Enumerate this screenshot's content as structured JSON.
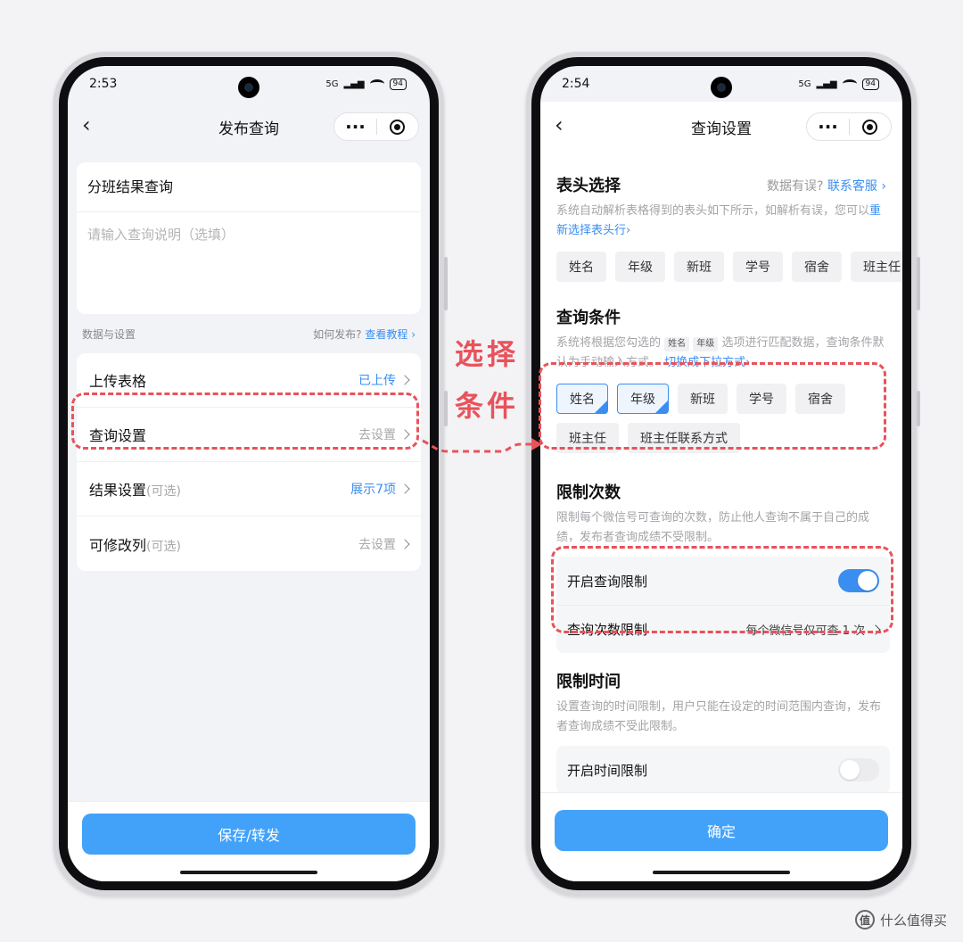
{
  "left": {
    "status_time": "2:53",
    "status_net": "5G",
    "battery": "94",
    "title": "发布查询",
    "query_name": "分班结果查询",
    "desc_placeholder": "请输入查询说明（选填）",
    "section_label": "数据与设置",
    "section_hint": "如何发布?",
    "section_link": "查看教程",
    "rows": [
      {
        "label": "上传表格",
        "note": "",
        "value": "已上传"
      },
      {
        "label": "查询设置",
        "note": "",
        "value": "去设置"
      },
      {
        "label": "结果设置",
        "note": "(可选)",
        "value": "展示7项"
      },
      {
        "label": "可修改列",
        "note": "(可选)",
        "value": "去设置"
      }
    ],
    "primary_button": "保存/转发"
  },
  "right": {
    "status_time": "2:54",
    "status_net": "5G",
    "battery": "94",
    "title": "查询设置",
    "header_section": {
      "title": "表头选择",
      "hint": "数据有误?",
      "link": "联系客服",
      "note": "系统自动解析表格得到的表头如下所示，如解析有误，您可以",
      "note_link": "重新选择表头行",
      "chips": [
        "姓名",
        "年级",
        "新班",
        "学号",
        "宿舍",
        "班主任"
      ]
    },
    "condition_section": {
      "title": "查询条件",
      "note_a": "系统将根据您勾选的",
      "tag_a": "姓名",
      "tag_b": "年级",
      "note_b": "选项进行匹配数据，查询条件默认为手动输入方式。",
      "note_link": "切换成下拉方式",
      "chips": [
        "姓名",
        "年级",
        "新班",
        "学号",
        "宿舍",
        "班主任",
        "班主任联系方式"
      ]
    },
    "limit_count": {
      "title": "限制次数",
      "note": "限制每个微信号可查询的次数，防止他人查询不属于自己的成绩，发布者查询成绩不受限制。",
      "toggle_label": "开启查询限制",
      "count_label": "查询次数限制",
      "count_value": "每个微信号仅可查 1 次"
    },
    "limit_time": {
      "title": "限制时间",
      "note": "设置查询的时间限制，用户只能在设定的时间范围内查询，发布者查询成绩不受此限制。",
      "toggle_label": "开启时间限制"
    },
    "primary_button": "确定"
  },
  "annotation": {
    "line1": "选择",
    "line2": "条件"
  },
  "watermark": "什么值得买",
  "watermark_badge": "值",
  "accent_color": "#3a8ef0",
  "annotation_color": "#e8535b"
}
